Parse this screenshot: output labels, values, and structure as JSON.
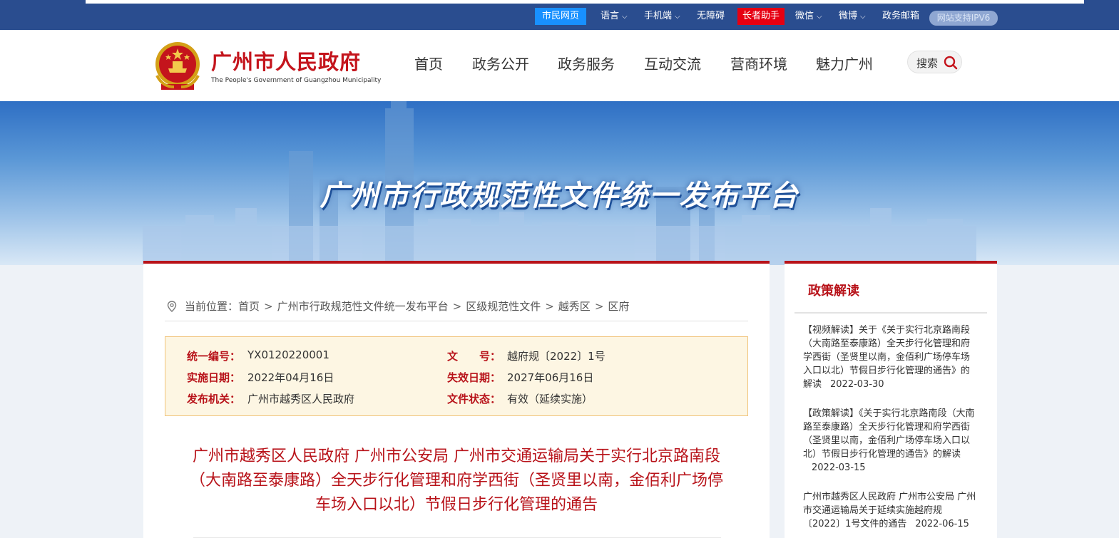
{
  "topbar": {
    "citizen_label": "市民网页",
    "language_label": "语言",
    "mobile_label": "手机端",
    "accessibility_label": "无障碍",
    "elder_label": "长者助手",
    "wechat_label": "微信",
    "weibo_label": "微博",
    "mail_label": "政务邮箱",
    "ipv6_label": "网站支持IPV6"
  },
  "header": {
    "logo_cn": "广州市人民政府",
    "logo_en": "The People's Government of Guangzhou Municipality",
    "nav": [
      "首页",
      "政务公开",
      "政务服务",
      "互动交流",
      "营商环境",
      "魅力广州"
    ],
    "search_label": "搜索"
  },
  "banner": {
    "title": "广州市行政规范性文件统一发布平台"
  },
  "breadcrumb": {
    "prefix": "当前位置：",
    "items": [
      "首页",
      "广州市行政规范性文件统一发布平台",
      "区级规范性文件",
      "越秀区",
      "区府"
    ]
  },
  "info": {
    "code_label": "统一编号：",
    "code_value": "YX0120220001",
    "doc_no_label": "文　　号：",
    "doc_no_value": "越府规〔2022〕1号",
    "start_label": "实施日期：",
    "start_value": "2022年04月16日",
    "end_label": "失效日期：",
    "end_value": "2027年06月16日",
    "issuer_label": "发布机关：",
    "issuer_value": "广州市越秀区人民政府",
    "status_label": "文件状态：",
    "status_value": "有效（延续实施）"
  },
  "document": {
    "title": "广州市越秀区人民政府 广州市公安局 广州市交通运输局关于实行北京路南段（大南路至泰康路）全天步行化管理和府学西街（圣贤里以南，金佰利广场停车场入口以北）节假日步行化管理的通告"
  },
  "side": {
    "title": "政策解读",
    "items": [
      {
        "text": "【视频解读】关于《关于实行北京路南段（大南路至泰康路）全天步行化管理和府学西街（圣贤里以南，金佰利广场停车场入口以北）节假日步行化管理的通告》的解读",
        "date": "2022-03-30"
      },
      {
        "text": "【政策解读】《关于实行北京路南段（大南路至泰康路）全天步行化管理和府学西街（圣贤里以南，金佰利广场停车场入口以北）节假日步行化管理的通告》的解读",
        "date": "2022-03-15"
      },
      {
        "text": "广州市越秀区人民政府 广州市公安局 广州市交通运输局关于延续实施越府规〔2022〕1号文件的通告",
        "date": "2022-06-15"
      }
    ]
  },
  "colors": {
    "topbar": "#2a4d8f",
    "brand_red": "#c4141c",
    "accent_red": "#b8131a",
    "citizen_blue": "#1890ff",
    "elder_red": "#e60012",
    "info_bg": "#fdf6e3",
    "info_border": "#f0c37a"
  }
}
